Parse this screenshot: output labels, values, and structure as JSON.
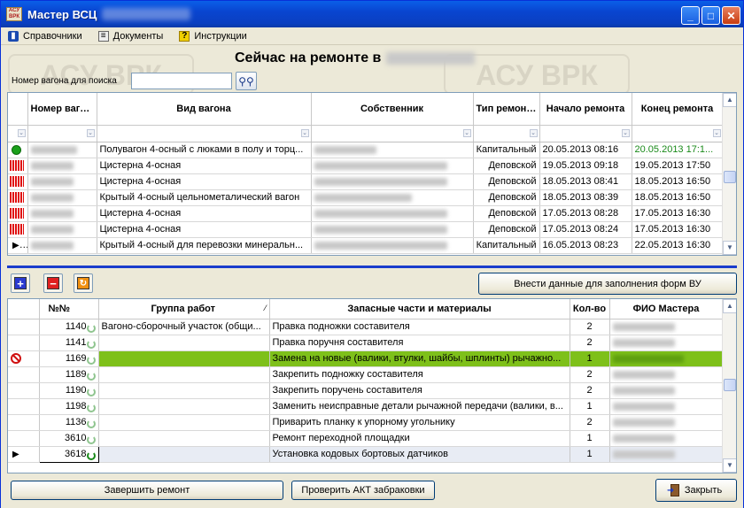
{
  "window": {
    "title": "Мастер ВСЦ"
  },
  "menu": [
    {
      "label": "Справочники",
      "icon": "book-icon"
    },
    {
      "label": "Документы",
      "icon": "documents-icon"
    },
    {
      "label": "Инструкции",
      "icon": "help-icon"
    }
  ],
  "watermark": "АСУ ВРК",
  "heading": "Сейчас на ремонте в",
  "search": {
    "label": "Номер вагона для поиска",
    "value": ""
  },
  "top_table": {
    "headers": [
      "Номер вагона",
      "Вид вагона",
      "Собственник",
      "Тип ремонта",
      "Начало ремонта",
      "Конец ремонта"
    ],
    "rows": [
      {
        "status": "green",
        "type": "Полувагон 4-осный с люками в полу и торц...",
        "repair": "Капитальный",
        "start": "20.05.2013 08:16",
        "end": "20.05.2013 17:1...",
        "end_color": "#1a8a1a"
      },
      {
        "status": "red",
        "type": "Цистерна 4-осная",
        "repair": "Деповской",
        "start": "19.05.2013 09:18",
        "end": "19.05.2013 17:50",
        "end_color": "#000000"
      },
      {
        "status": "red",
        "type": "Цистерна 4-осная",
        "repair": "Деповской",
        "start": "18.05.2013 08:41",
        "end": "18.05.2013 16:50",
        "end_color": "#000000"
      },
      {
        "status": "red",
        "type": "Крытый 4-осный цельнометалический вагон",
        "repair": "Деповской",
        "start": "18.05.2013 08:39",
        "end": "18.05.2013 16:50",
        "end_color": "#000000"
      },
      {
        "status": "red",
        "type": "Цистерна 4-осная",
        "repair": "Деповской",
        "start": "17.05.2013 08:28",
        "end": "17.05.2013 16:30",
        "end_color": "#000000"
      },
      {
        "status": "red",
        "type": "Цистерна 4-осная",
        "repair": "Деповской",
        "start": "17.05.2013 08:24",
        "end": "17.05.2013 16:30",
        "end_color": "#000000"
      },
      {
        "status": "red",
        "type": "Крытый 4-осный для перевозки минеральн...",
        "repair": "Капитальный",
        "start": "16.05.2013 08:23",
        "end": "22.05.2013 16:30",
        "end_color": "#000000"
      }
    ]
  },
  "fill_forms_button": "Внести данные для заполнения форм ВУ",
  "bottom_table": {
    "headers": [
      "№№",
      "Группа работ",
      "Запасные части и материалы",
      "Кол-во",
      "ФИО Мастера"
    ],
    "rows": [
      {
        "num": "1140",
        "group": "Вагоно-сборочный участок (общи...",
        "part": "Правка подножки составителя",
        "qty": "2",
        "state": "normal"
      },
      {
        "num": "1141",
        "group": "",
        "part": "Правка поручня составителя",
        "qty": "2",
        "state": "normal"
      },
      {
        "num": "1169",
        "group": "",
        "part": "Замена на новые (валики, втулки, шайбы, шплинты) рычажно...",
        "qty": "1",
        "state": "selected"
      },
      {
        "num": "1189",
        "group": "",
        "part": "Закрепить подножку составителя",
        "qty": "2",
        "state": "normal"
      },
      {
        "num": "1190",
        "group": "",
        "part": "Закрепить поручень составителя",
        "qty": "2",
        "state": "normal"
      },
      {
        "num": "1198",
        "group": "",
        "part": "Заменить неисправные детали рычажной передачи (валики, в...",
        "qty": "1",
        "state": "normal"
      },
      {
        "num": "1136",
        "group": "",
        "part": "Приварить планку к упорному угольнику",
        "qty": "2",
        "state": "normal"
      },
      {
        "num": "3610",
        "group": "",
        "part": "Ремонт переходной площадки",
        "qty": "1",
        "state": "normal"
      },
      {
        "num": "3618",
        "group": "",
        "part": "Установка кодовых бортовых датчиков",
        "qty": "1",
        "state": "current"
      }
    ]
  },
  "buttons": {
    "finish": "Завершить ремонт",
    "check": "Проверить АКТ забраковки",
    "close": "Закрыть"
  }
}
